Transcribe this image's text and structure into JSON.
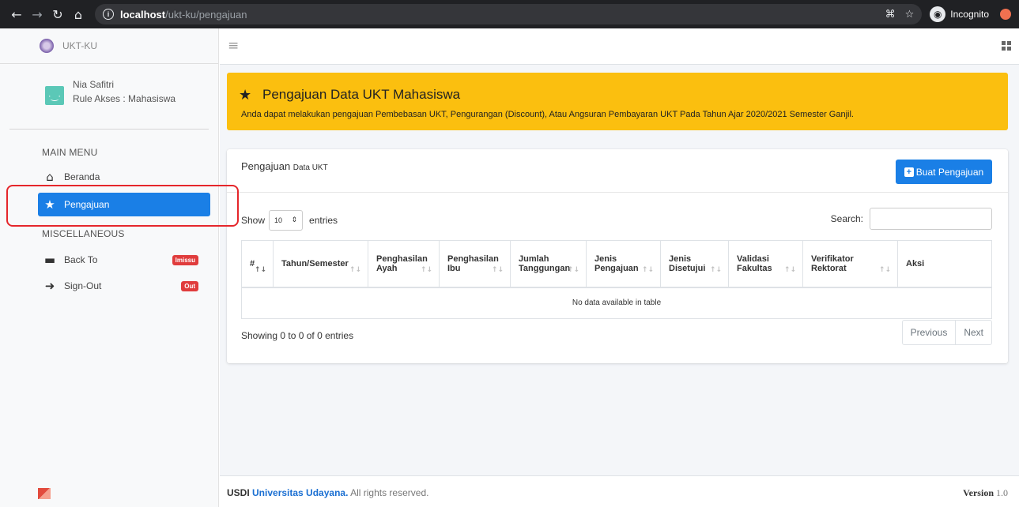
{
  "browser": {
    "url_host": "localhost",
    "url_path": "/ukt-ku/pengajuan",
    "profile_label": "Incognito"
  },
  "sidebar": {
    "brand": "UKT-KU",
    "user": {
      "name": "Nia Safitri",
      "role": "Rule Akses : Mahasiswa",
      "avatar_glyph": "·‿·"
    },
    "main_menu_label": "MAIN MENU",
    "main_items": [
      {
        "label": "Beranda",
        "icon": "home-icon"
      },
      {
        "label": "Pengajuan",
        "icon": "star-icon",
        "active": true
      }
    ],
    "misc_label": "MISCELLANEOUS",
    "misc_items": [
      {
        "label": "Back To",
        "icon": "keyboard-icon",
        "badge": "Imissu"
      },
      {
        "label": "Sign-Out",
        "icon": "sign-out-icon",
        "badge": "Out"
      }
    ]
  },
  "alert": {
    "title": "Pengajuan Data UKT Mahasiswa",
    "text": "Anda dapat melakukan pengajuan Pembebasan UKT, Pengurangan (Discount), Atau Angsuran Pembayaran UKT Pada Tahun Ajar 2020/2021 Semester Ganjil."
  },
  "card": {
    "title_main": "Pengajuan",
    "title_small": "Data UKT",
    "create_button": "Buat Pengajuan",
    "show_label": "Show",
    "entries_value": "10",
    "entries_label": "entries",
    "search_label": "Search:",
    "columns": [
      {
        "line1": "#",
        "line2": ""
      },
      {
        "line1": "Tahun/Semester",
        "line2": ""
      },
      {
        "line1": "Penghasilan",
        "line2": "Ayah"
      },
      {
        "line1": "Penghasilan",
        "line2": "Ibu"
      },
      {
        "line1": "Jumlah",
        "line2": "Tanggungan"
      },
      {
        "line1": "Jenis",
        "line2": "Pengajuan"
      },
      {
        "line1": "Jenis",
        "line2": "Disetujui"
      },
      {
        "line1": "Validasi",
        "line2": "Fakultas"
      },
      {
        "line1": "Verifikator",
        "line2": "Rektorat"
      },
      {
        "line1": "Aksi",
        "line2": ""
      }
    ],
    "empty_text": "No data available in table",
    "info_text": "Showing 0 to 0 of 0 entries",
    "prev_label": "Previous",
    "next_label": "Next"
  },
  "footer": {
    "org": "USDI",
    "university": "Universitas Udayana.",
    "rights": "All rights reserved.",
    "version_label": "Version",
    "version_number": "1.0"
  },
  "colors": {
    "primary": "#1a7fe6",
    "warning": "#fbbf0f",
    "danger": "#e03c3c",
    "highlight": "#e5262b"
  }
}
